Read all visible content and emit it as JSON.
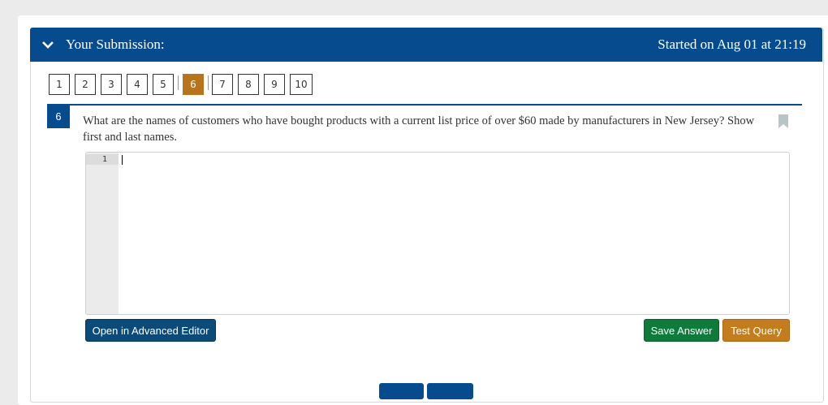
{
  "header": {
    "title": "Your Submission:",
    "started": "Started on Aug 01 at 21:19"
  },
  "question_nav": {
    "items": [
      "1",
      "2",
      "3",
      "4",
      "5",
      "6",
      "7",
      "8",
      "9",
      "10"
    ],
    "active": "6"
  },
  "question": {
    "number": "6",
    "text": "What are the names of customers who have bought products with a current list price of over $60 made by manufacturers in New Jersey? Show first and last names."
  },
  "editor": {
    "line_numbers": [
      "1"
    ],
    "content": ""
  },
  "buttons": {
    "advanced_editor": "Open in Advanced Editor",
    "save_answer": "Save Answer",
    "test_query": "Test Query"
  },
  "colors": {
    "header": "#074b8f",
    "active_question": "#b8741a",
    "save": "#0e7a3c",
    "test": "#c47d1e",
    "advanced": "#0c4a7a"
  },
  "icons": {
    "collapse": "chevron-down-icon",
    "bookmark": "bookmark-icon"
  }
}
